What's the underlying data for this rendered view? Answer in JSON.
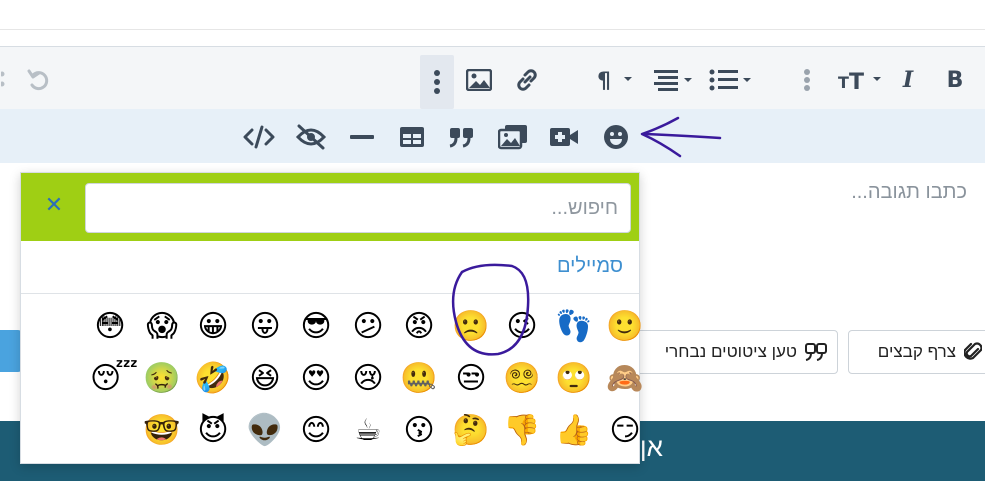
{
  "toolbar": {
    "row1_buttons": [
      {
        "name": "bold-button",
        "glyph": "B"
      },
      {
        "name": "italic-button",
        "glyph": "I"
      },
      {
        "name": "font-size-button",
        "glyph": "тT"
      },
      {
        "name": "more-text-options-button",
        "glyph": "⋮"
      },
      {
        "name": "list-button",
        "glyph": "☰"
      },
      {
        "name": "align-button",
        "glyph": "≡"
      },
      {
        "name": "paragraph-button",
        "glyph": "¶"
      },
      {
        "name": "link-button",
        "glyph": "🔗"
      },
      {
        "name": "image-button",
        "glyph": "🖼"
      },
      {
        "name": "more-options-button",
        "glyph": "⋮"
      },
      {
        "name": "undo-button",
        "glyph": "↶"
      }
    ],
    "row2_buttons": [
      {
        "name": "emoji-button",
        "icon": "smiley-icon"
      },
      {
        "name": "video-button",
        "icon": "video-plus-icon"
      },
      {
        "name": "media-button",
        "icon": "media-icon"
      },
      {
        "name": "quote-button",
        "icon": "quote-icon"
      },
      {
        "name": "table-button",
        "icon": "table-icon"
      },
      {
        "name": "horizontal-line-button",
        "icon": "minus-icon"
      },
      {
        "name": "spoiler-button",
        "icon": "eye-slash-icon"
      },
      {
        "name": "code-button",
        "icon": "code-icon"
      }
    ]
  },
  "editor": {
    "placeholder": "כתבו תגובה..."
  },
  "actions": {
    "attach_label": "צרף קבצים",
    "quotes_label": "טען ציטוטים נבחרי"
  },
  "submit": {
    "label": "אן"
  },
  "emoji_popup": {
    "search_placeholder": "חיפוש...",
    "close_glyph": "✕",
    "category_label": "סמיילים",
    "rows": [
      [
        "🙂",
        "👣",
        "😉",
        "🙁",
        "😡",
        "😕",
        "😎",
        "😛",
        "😀",
        "😱",
        "😳"
      ],
      [
        "🙈",
        "🙄",
        "😵‍💫",
        "😒",
        "🤐",
        "😢",
        "😍",
        "😆",
        "🤣",
        "🤢",
        "😴"
      ],
      [
        "😏",
        "👍",
        "👎",
        "🤔",
        "😗",
        "☕",
        "😊",
        "👽",
        "😈",
        "🤓"
      ]
    ]
  },
  "colors": {
    "popup_header": "#9fcf14",
    "accent_link": "#3e8fd0",
    "submit_bar": "#1d5c74",
    "annotation": "#3a1a9c"
  }
}
